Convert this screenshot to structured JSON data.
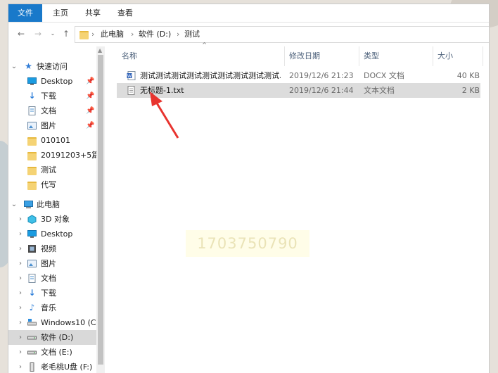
{
  "ribbon": {
    "tabs": [
      {
        "label": "文件",
        "active": true
      },
      {
        "label": "主页",
        "active": false
      },
      {
        "label": "共享",
        "active": false
      },
      {
        "label": "查看",
        "active": false
      }
    ]
  },
  "address": {
    "crumbs": [
      "此电脑",
      "软件 (D:)",
      "测试"
    ]
  },
  "sidebar": {
    "quick_access": "快速访问",
    "quick_items": [
      {
        "label": "Desktop",
        "icon": "desktop-icon",
        "pinned": true
      },
      {
        "label": "下载",
        "icon": "download-icon",
        "pinned": true
      },
      {
        "label": "文档",
        "icon": "document-icon",
        "pinned": true
      },
      {
        "label": "图片",
        "icon": "picture-icon",
        "pinned": true
      },
      {
        "label": "010101",
        "icon": "folder-icon",
        "pinned": false
      },
      {
        "label": "20191203+5篇",
        "icon": "folder-icon",
        "pinned": false
      },
      {
        "label": "测试",
        "icon": "folder-icon",
        "pinned": false
      },
      {
        "label": "代写",
        "icon": "folder-icon",
        "pinned": false
      }
    ],
    "this_pc": "此电脑",
    "pc_items": [
      {
        "label": "3D 对象",
        "icon": "3d-objects-icon",
        "selected": false
      },
      {
        "label": "Desktop",
        "icon": "desktop-icon",
        "selected": false
      },
      {
        "label": "视频",
        "icon": "video-icon",
        "selected": false
      },
      {
        "label": "图片",
        "icon": "picture-icon",
        "selected": false
      },
      {
        "label": "文档",
        "icon": "document-icon",
        "selected": false
      },
      {
        "label": "下载",
        "icon": "download-icon",
        "selected": false
      },
      {
        "label": "音乐",
        "icon": "music-icon",
        "selected": false
      },
      {
        "label": "Windows10 (C:",
        "icon": "drive-icon",
        "selected": false
      },
      {
        "label": "软件 (D:)",
        "icon": "drive-icon",
        "selected": true
      },
      {
        "label": "文档 (E:)",
        "icon": "drive-icon",
        "selected": false
      },
      {
        "label": "老毛桃U盘 (F:)",
        "icon": "usb-drive-icon",
        "selected": false
      }
    ]
  },
  "columns": {
    "name": "名称",
    "modified": "修改日期",
    "type": "类型",
    "size": "大小"
  },
  "files": [
    {
      "name": "测试测试测试测试测试测试测试测试测试...",
      "modified": "2019/12/6 21:23",
      "type": "DOCX 文档",
      "size": "40 KB",
      "icon": "word-document-icon",
      "selected": false
    },
    {
      "name": "无标题-1.txt",
      "modified": "2019/12/6 21:44",
      "type": "文本文档",
      "size": "2 KB",
      "icon": "text-file-icon",
      "selected": true
    }
  ],
  "watermark": "1703750790",
  "colors": {
    "accent": "#1979ca",
    "selection": "#dcdcdc",
    "annotation_arrow": "#e8342f"
  }
}
